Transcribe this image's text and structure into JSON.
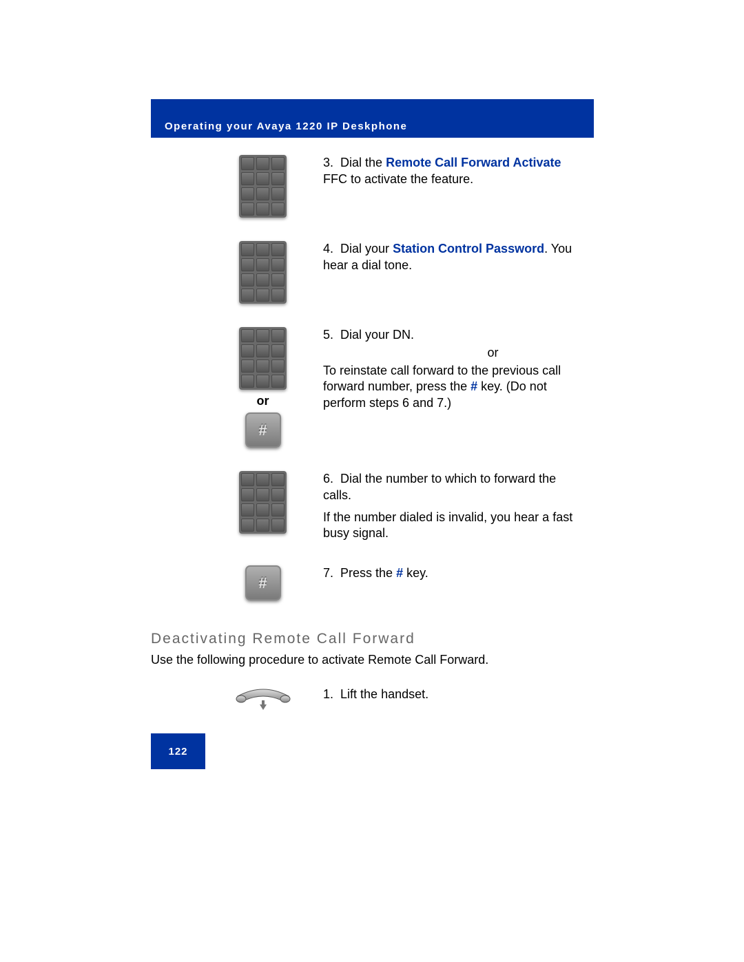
{
  "header": {
    "title": "Operating your Avaya 1220 IP Deskphone"
  },
  "steps": {
    "s3": {
      "num": "3.",
      "pre": "Dial the ",
      "bold": "Remote Call Forward Activate",
      "post": " FFC to activate the feature."
    },
    "s4": {
      "num": "4.",
      "pre": "Dial your ",
      "bold": "Station Control Password",
      "post": ". You hear a dial tone."
    },
    "s5": {
      "num": "5.",
      "line1": "Dial your DN.",
      "or": "or",
      "line2a": "To reinstate call forward to the previous call forward number, press the ",
      "hash": "#",
      "line2b": " key. (Do not perform steps 6 and 7.)"
    },
    "or_label": "or",
    "s6": {
      "num": "6.",
      "line1": "Dial the number to which to forward the calls.",
      "line2": "If the number dialed is invalid, you hear a fast busy signal."
    },
    "s7": {
      "num": "7.",
      "pre": "Press the ",
      "hash": "#",
      "post": " key."
    }
  },
  "section2": {
    "heading": "Deactivating Remote Call Forward",
    "intro": "Use the following procedure to activate Remote Call Forward.",
    "step1": {
      "num": "1.",
      "text": "Lift the handset."
    }
  },
  "footer": {
    "page": "122"
  }
}
